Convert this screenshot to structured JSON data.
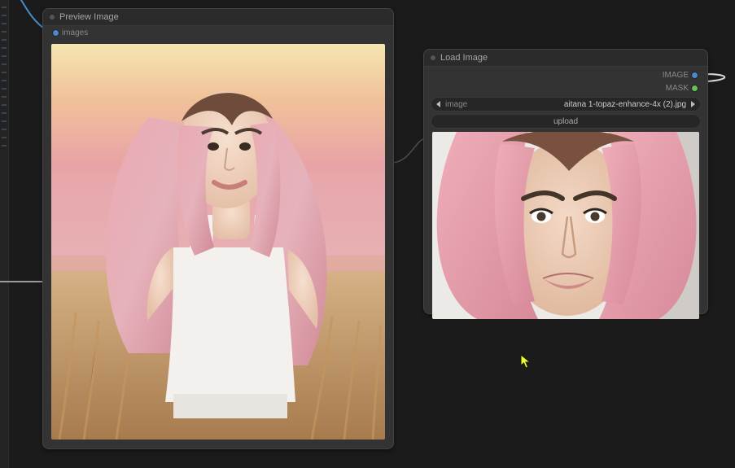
{
  "preview_node": {
    "title": "Preview Image",
    "input_label": "images"
  },
  "load_node": {
    "title": "Load Image",
    "output_image": "IMAGE",
    "output_mask": "MASK",
    "combo_label": "image",
    "combo_value": "aitana 1-topaz-enhance-4x (2).jpg",
    "upload_label": "upload"
  }
}
